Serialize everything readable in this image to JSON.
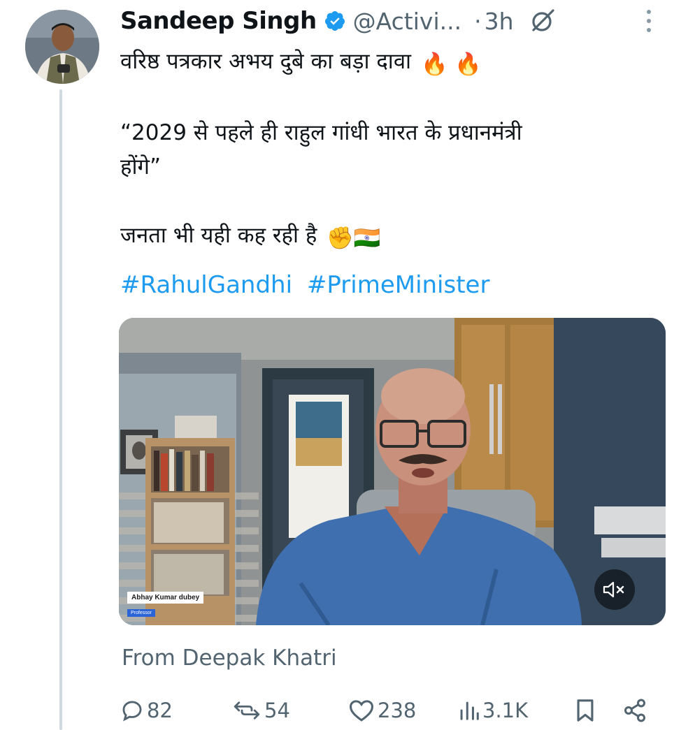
{
  "author": {
    "name": "Sandeep Singh",
    "handle": "@Activi...",
    "separator": "·",
    "time": "3h",
    "verified": true
  },
  "tweet": {
    "line1": "वरिष्ठ पत्रकार अभय दुबे का बड़ा दावा",
    "line1_emoji": "🔥 🔥",
    "quote_line1": "“2029 से पहले ही राहुल गांधी भारत के प्रधानमंत्री",
    "quote_line2": "होंगे”",
    "line3": "जनता भी यही कह रही है",
    "line3_emoji": "✊🇮🇳",
    "hashtags": [
      "#RahulGandhi",
      "#PrimeMinister"
    ]
  },
  "video": {
    "name_tag": "Abhay Kumar dubey",
    "role_tag": "Professor",
    "muted": true,
    "mute_icon": "speaker-muted-icon"
  },
  "attribution": "From Deepak Khatri",
  "actions": {
    "replies": "82",
    "reposts": "54",
    "likes": "238",
    "views": "3.1K"
  },
  "colors": {
    "text": "#0f1419",
    "secondary": "#536471",
    "link": "#1d9bf0",
    "verified": "#1d9bf0",
    "thread_line": "#cfd9de"
  }
}
